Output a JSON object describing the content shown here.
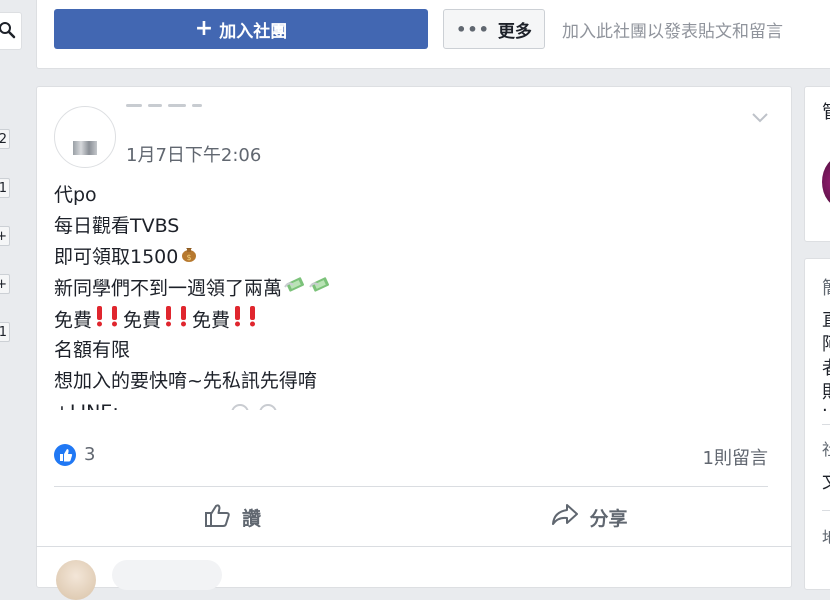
{
  "top_bar": {
    "join_button_label": "加入社團",
    "more_button_label": "更多",
    "join_hint": "加入此社團以發表貼文和留言"
  },
  "left_badges": [
    "2",
    "1",
    "+",
    "+",
    "1"
  ],
  "post": {
    "timestamp": "1月7日下午2:06",
    "lines": [
      {
        "text": "代po"
      },
      {
        "text": "每日觀看TVBS"
      },
      {
        "text": "即可領取1500",
        "emoji": [
          "money-bag"
        ]
      },
      {
        "text": "新同學們不到一週領了兩萬",
        "emoji": [
          "money-wings",
          "money-wings"
        ]
      },
      {
        "segments": [
          "免費",
          "免費",
          "免費"
        ],
        "emoji_between": "double-exclamation"
      },
      {
        "text": "名額有限"
      },
      {
        "text": "想加入的要快唷~先私訊先得唷"
      },
      {
        "text": "+LINE:"
      }
    ],
    "reaction_count": "3",
    "comment_count": "1則留言",
    "like_label": "讚",
    "share_label": "分享"
  },
  "right_column": {
    "card1_char": "管",
    "card2_chars": [
      "簡",
      "直",
      "阿",
      "者",
      "則",
      "·"
    ],
    "card2_chars_lower": [
      "社",
      "文",
      "地"
    ]
  },
  "colors": {
    "brand_blue": "#4267b2",
    "page_bg": "#e9ebee",
    "muted_text": "#616770",
    "like_blue": "#2078f4"
  }
}
